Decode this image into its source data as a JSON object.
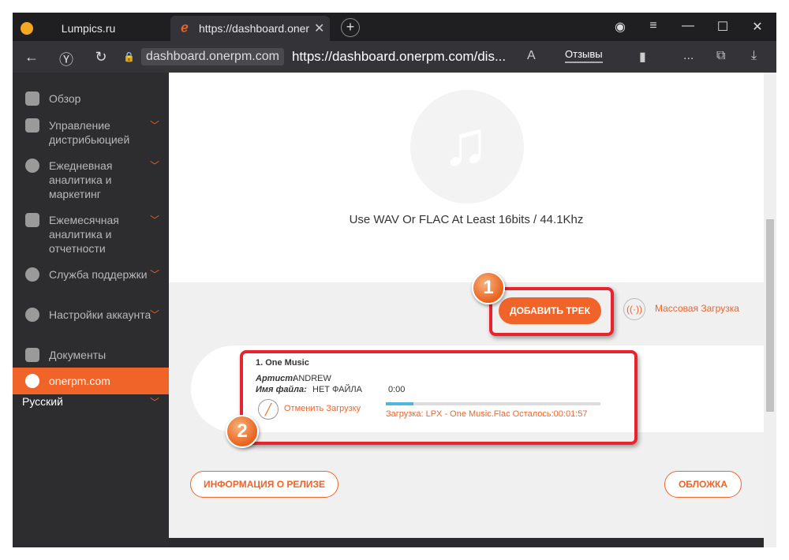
{
  "browser": {
    "tabs": [
      {
        "title": "Lumpics.ru"
      },
      {
        "title": "https://dashboard.onerpm.com/distribution"
      }
    ],
    "host": "dashboard.onerpm.com",
    "url": "https://dashboard.onerpm.com/dis...",
    "reviews": "Отзывы",
    "menu_more": "..."
  },
  "sidebar": {
    "items": [
      {
        "label": "Обзор"
      },
      {
        "label": "Управление дистрибьюцией"
      },
      {
        "label": "Ежедневная аналитика и маркетинг"
      },
      {
        "label": "Ежемесячная аналитика и отчетности"
      },
      {
        "label": "Служба поддержки"
      },
      {
        "label": "Настройки аккаунта"
      },
      {
        "label": "Документы"
      },
      {
        "label": "onerpm.com"
      }
    ],
    "language": "Русский"
  },
  "main": {
    "format_hint": "Use WAV Or FLAC At Least 16bits / 44.1Khz",
    "add_track": "ДОБАВИТЬ ТРЕК",
    "bulk_upload": "Массовая Загрузка",
    "track": {
      "title": "1. One Music",
      "artist_label": "Артист:",
      "artist": "ANDREW",
      "file_label": "Имя файла:",
      "file": "НЕТ ФАЙЛА",
      "time": "0:00",
      "progress": 0.13,
      "cancel": "Отменить Загрузку",
      "upload_status": "Загрузка: LPX - One Music.Flac Осталось:00:01:57"
    },
    "release_info": "ИНФОРМАЦИЯ О РЕЛИЗЕ",
    "cover": "ОБЛОЖКА"
  },
  "annotations": {
    "badge1": "1",
    "badge2": "2"
  },
  "colors": {
    "accent": "#f0642a",
    "highlight": "#e8232d",
    "progress": "#4fb6df"
  }
}
